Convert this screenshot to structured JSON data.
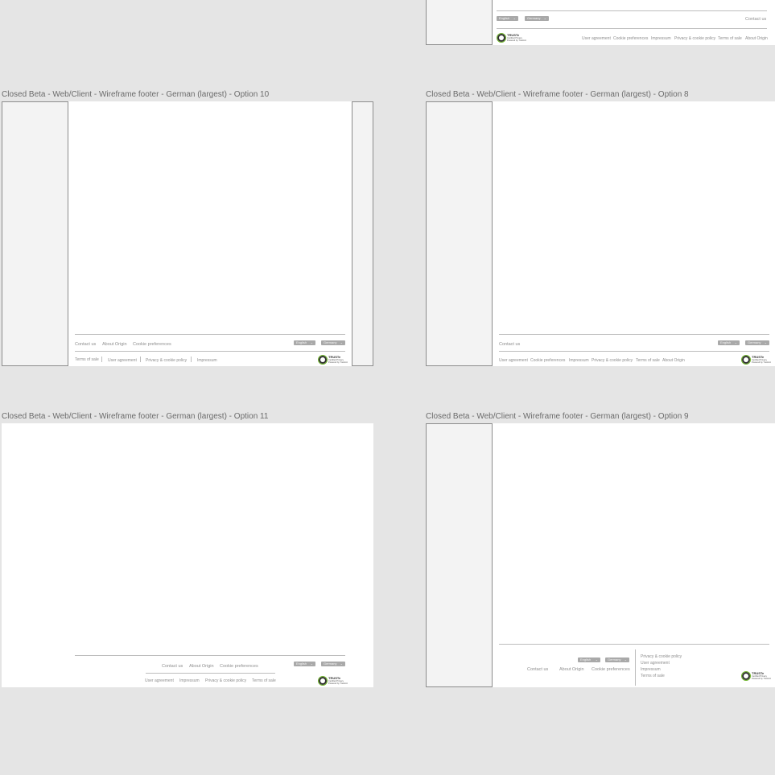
{
  "frames": {
    "top_right": {
      "lang": "English",
      "country": "Germany",
      "contact": "Contact us",
      "links": [
        "User agreement",
        "Cookie preferences",
        "Impressum",
        "Privacy & cookie policy",
        "Terms of sale",
        "About Origin"
      ]
    },
    "option10": {
      "title": "Closed Beta - Web/Client - Wireframe footer - German (largest) - Option 10",
      "primary": [
        "Contact us",
        "About Origin",
        "Cookie preferences"
      ],
      "lang": "English",
      "country": "Germany",
      "secondary": [
        "Terms of sale",
        "User agreement",
        "Privacy & cookie policy",
        "Impressum"
      ]
    },
    "option8": {
      "title": "Closed Beta - Web/Client - Wireframe footer - German (largest) - Option 8",
      "contact": "Contact us",
      "lang": "English",
      "country": "Germany",
      "links": [
        "User agreement",
        "Cookie preferences",
        "Impressum",
        "Privacy & cookie policy",
        "Terms of sale",
        "About Origin"
      ]
    },
    "option11": {
      "title": "Closed Beta - Web/Client - Wireframe footer - German (largest) - Option 11",
      "primary": [
        "Contact us",
        "About Origin",
        "Cookie preferences"
      ],
      "lang": "English",
      "country": "Germany",
      "secondary": [
        "User agreement",
        "Impressum",
        "Privacy & cookie policy",
        "Terms of sale"
      ]
    },
    "option9": {
      "title": "Closed Beta - Web/Client - Wireframe footer - German (largest) - Option 9",
      "lang": "English",
      "country": "Germany",
      "primary": [
        "Contact us",
        "About Origin",
        "Cookie preferences"
      ],
      "stacked": [
        "Privacy & cookie policy",
        "User agreement",
        "Impressum",
        "Terms of sale"
      ]
    }
  },
  "badge": {
    "title": "TRUSTe",
    "line1": "Certified Privacy",
    "line2": "Powered by TrustArc"
  },
  "icons": {
    "chevron": "chevron-down-icon",
    "trust_badge": "truste-seal-icon"
  }
}
